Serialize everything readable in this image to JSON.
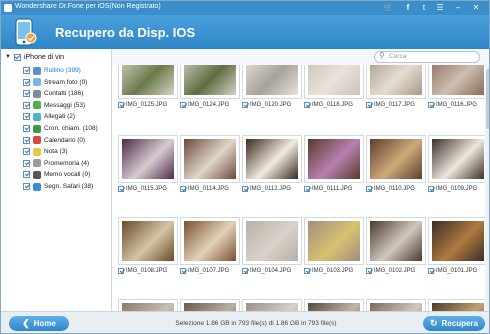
{
  "window": {
    "title": "Wondershare Dr.Fone per iOS(Non Registrato)",
    "controls": [
      "cart-icon",
      "facebook-icon",
      "twitter-icon",
      "menu-icon",
      "minimize-icon",
      "close-icon"
    ]
  },
  "header": {
    "title": "Recupero da Disp. IOS"
  },
  "sidebar": {
    "root_label": "iPhone di vin",
    "items": [
      {
        "label": "Rullino (399)",
        "icon": "camera-roll-icon",
        "color": "#5a8fc7",
        "selected": true
      },
      {
        "label": "Stream foto (0)",
        "icon": "photo-stream-icon",
        "color": "#7fb3e0"
      },
      {
        "label": "Contatti (186)",
        "icon": "contacts-icon",
        "color": "#7a8c99"
      },
      {
        "label": "Messaggi (53)",
        "icon": "messages-icon",
        "color": "#52b043"
      },
      {
        "label": "Allegati (2)",
        "icon": "attachments-icon",
        "color": "#4bb2d6"
      },
      {
        "label": "Cron. chiam. (108)",
        "icon": "call-history-icon",
        "color": "#3a9a45"
      },
      {
        "label": "Calendario (0)",
        "icon": "calendar-icon",
        "color": "#d64a3b"
      },
      {
        "label": "Nota (3)",
        "icon": "notes-icon",
        "color": "#e6c84a"
      },
      {
        "label": "Promemoria (4)",
        "icon": "reminders-icon",
        "color": "#9b9b9b"
      },
      {
        "label": "Memo vocali (0)",
        "icon": "voice-memos-icon",
        "color": "#555555"
      },
      {
        "label": "Segn. Safari (38)",
        "icon": "safari-bookmarks-icon",
        "color": "#3a8ed6"
      }
    ]
  },
  "search": {
    "placeholder": "Cerca"
  },
  "photos": [
    {
      "name": "IMG_0125.JPG",
      "colors": [
        "#d8d2c6",
        "#6a7a4a"
      ]
    },
    {
      "name": "IMG_0124.JPG",
      "colors": [
        "#d4d0c8",
        "#5f6d3e"
      ]
    },
    {
      "name": "IMG_0120.JPG",
      "colors": [
        "#e6e2da",
        "#a8a39a"
      ]
    },
    {
      "name": "IMG_0118.JPG",
      "colors": [
        "#c9c3b8",
        "#e8e2d8"
      ]
    },
    {
      "name": "IMG_0117.JPG",
      "colors": [
        "#a89a8a",
        "#e6ddd0"
      ]
    },
    {
      "name": "IMG_0116.JPG",
      "colors": [
        "#8a6a5a",
        "#cdbfae"
      ]
    },
    {
      "name": "IMG_0115.JPG",
      "colors": [
        "#4a2a4a",
        "#d8ccd0"
      ]
    },
    {
      "name": "IMG_0114.JPG",
      "colors": [
        "#6a4a3a",
        "#e0d6c8"
      ]
    },
    {
      "name": "IMG_0112.JPG",
      "colors": [
        "#3a2a1a",
        "#f0eadf"
      ]
    },
    {
      "name": "IMG_0111.JPG",
      "colors": [
        "#5a3a2a",
        "#b880b0"
      ]
    },
    {
      "name": "IMG_0110.JPG",
      "colors": [
        "#5a4030",
        "#d0a878"
      ]
    },
    {
      "name": "IMG_0109.JPG",
      "colors": [
        "#3a3028",
        "#ece6dc"
      ]
    },
    {
      "name": "IMG_0108.JPG",
      "colors": [
        "#6a4a2a",
        "#d4c4a4"
      ]
    },
    {
      "name": "IMG_0107.JPG",
      "colors": [
        "#7a5030",
        "#e2d2b8"
      ]
    },
    {
      "name": "IMG_0104.JPG",
      "colors": [
        "#b8b0a6",
        "#d8d2ca"
      ]
    },
    {
      "name": "IMG_0103.JPG",
      "colors": [
        "#a09080",
        "#d8c070"
      ]
    },
    {
      "name": "IMG_0102.JPG",
      "colors": [
        "#4a3a30",
        "#d0c8bc"
      ]
    },
    {
      "name": "IMG_0101.JPG",
      "colors": [
        "#3a2e26",
        "#b07a40"
      ]
    },
    {
      "name": "",
      "colors": [
        "#8a7a6a",
        "#c8bfb2"
      ]
    },
    {
      "name": "",
      "colors": [
        "#6a5a4a",
        "#bbb0a0"
      ]
    },
    {
      "name": "",
      "colors": [
        "#9a9088",
        "#d6d0c8"
      ]
    },
    {
      "name": "",
      "colors": [
        "#5a4a3a",
        "#c0b4a4"
      ]
    },
    {
      "name": "",
      "colors": [
        "#7a6a5a",
        "#d2c8bc"
      ]
    },
    {
      "name": "",
      "colors": [
        "#4a3a2e",
        "#c4a070"
      ]
    }
  ],
  "footer": {
    "home_label": "Home",
    "status": "Selezione 1.86 GB in 793 file(s) di 1.86 GB in 793 file(s)",
    "recover_label": "Recupera"
  },
  "colors": {
    "accent": "#2f86c6",
    "header": "#3a94d6"
  }
}
